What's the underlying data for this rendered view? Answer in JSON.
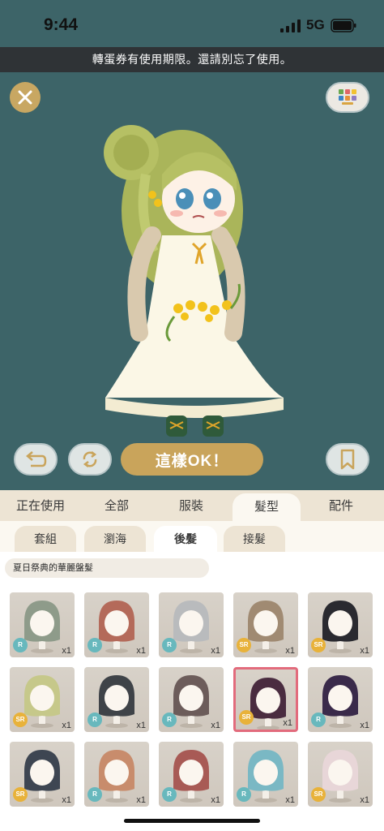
{
  "status_bar": {
    "time": "9:44",
    "network": "5G"
  },
  "banner": {
    "text": "轉蛋券有使用期限。還請別忘了使用。"
  },
  "toolbar": {
    "confirm_label": "這樣OK！"
  },
  "category_tabs": [
    {
      "label": "正在使用"
    },
    {
      "label": "全部"
    },
    {
      "label": "服裝"
    },
    {
      "label": "髮型",
      "active": true
    },
    {
      "label": "配件"
    }
  ],
  "sub_tabs": [
    {
      "label": "套組"
    },
    {
      "label": "瀏海"
    },
    {
      "label": "後髮",
      "active": true
    },
    {
      "label": "接髮"
    }
  ],
  "set_name": "夏日祭典的華麗盤髮",
  "items": [
    {
      "rarity": "R",
      "count": "x1",
      "hair_color": "#8e9b8a"
    },
    {
      "rarity": "R",
      "count": "x1",
      "hair_color": "#b46a5a"
    },
    {
      "rarity": "R",
      "count": "x1",
      "hair_color": "#b9bbbd"
    },
    {
      "rarity": "SR",
      "count": "x1",
      "hair_color": "#a08a72"
    },
    {
      "rarity": "SR",
      "count": "x1",
      "hair_color": "#2a2a30"
    },
    {
      "rarity": "SR",
      "count": "x1",
      "hair_color": "#c6c88a"
    },
    {
      "rarity": "R",
      "count": "x1",
      "hair_color": "#3f4348"
    },
    {
      "rarity": "R",
      "count": "x1",
      "hair_color": "#6c5c5a"
    },
    {
      "rarity": "SR",
      "count": "x1",
      "hair_color": "#4a2c40",
      "selected": true
    },
    {
      "rarity": "R",
      "count": "x1",
      "hair_color": "#3a2a4a"
    },
    {
      "rarity": "SR",
      "count": "x1",
      "hair_color": "#3e4652"
    },
    {
      "rarity": "R",
      "count": "x1",
      "hair_color": "#c88c6c"
    },
    {
      "rarity": "R",
      "count": "x1",
      "hair_color": "#a85a55"
    },
    {
      "rarity": "R",
      "count": "x1",
      "hair_color": "#7ab8c4"
    },
    {
      "rarity": "SR",
      "count": "x1",
      "hair_color": "#e8d6d8"
    }
  ],
  "colors": {
    "background": "#3d6468",
    "accent_gold": "#c9a45b",
    "selected_border": "#e26b7c",
    "rarity_r": "#68b8bd",
    "rarity_sr": "#e8b23a"
  },
  "icons": {
    "close": "close-icon",
    "palette": "palette-grid-icon",
    "undo": "undo-arrow-icon",
    "rotate": "rotate-icon",
    "bookmark": "bookmark-icon"
  }
}
